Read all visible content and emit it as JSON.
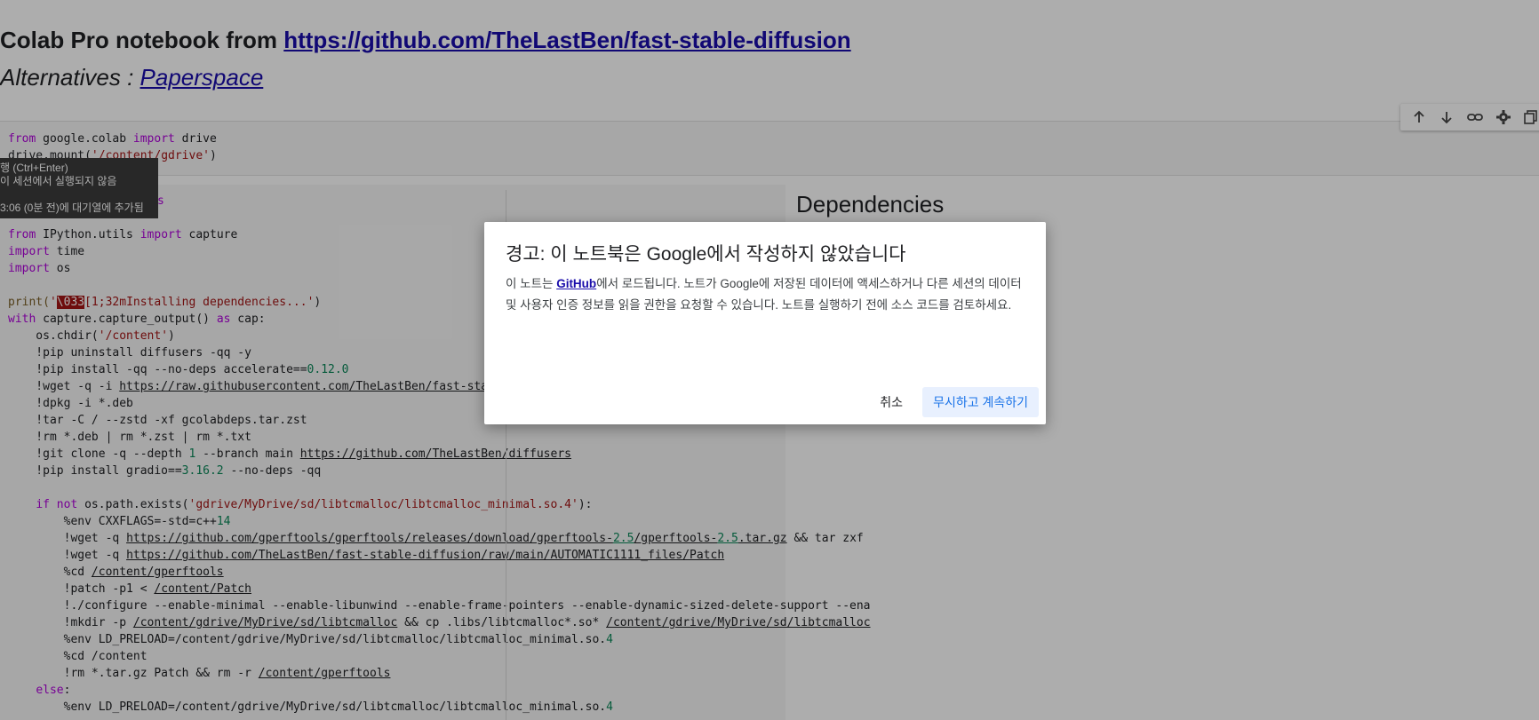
{
  "markdown": {
    "heading_text": "Colab Pro notebook from ",
    "heading_link": "https://github.com/TheLastBen/fast-stable-diffusion",
    "alt_text": "Alternatives : ",
    "alt_link": "Paperspace"
  },
  "cell_toolbar": {
    "icons": [
      "arrow-up-icon",
      "arrow-down-icon",
      "link-icon",
      "gear-icon",
      "copy-icon"
    ]
  },
  "cell1_code": {
    "line1_a": "from",
    "line1_b": " google.colab ",
    "line1_c": "import",
    "line1_d": " drive",
    "line2_a": "drive.mount(",
    "line2_b": "'/content/gdrive'",
    "line2_c": ")"
  },
  "tooltip": {
    "line1": "행 (Ctrl+Enter)",
    "line2": "이 세션에서 실행되지 않음",
    "line3": "",
    "line4": "3:06 (0분 전)에 대기열에 추가됨",
    "cell_fragment": "s"
  },
  "cell2_code": {
    "l1": [
      "from",
      " IPython.utils ",
      "import",
      " capture"
    ],
    "l2": [
      "import",
      " time"
    ],
    "l3": [
      "import",
      " os"
    ],
    "l5": [
      "print(",
      "'",
      "\\033",
      "[1;32mInstalling dependencies...'",
      ")"
    ],
    "l6": [
      "with",
      " capture.capture_output() ",
      "as",
      " cap:"
    ],
    "l7": [
      "    os.chdir(",
      "'/content'",
      ")"
    ],
    "l8": "    !pip uninstall diffusers -qq -y",
    "l9": [
      "    !pip install -qq --no-deps accelerate==",
      "0.12.0"
    ],
    "l10": [
      "    !wget -q -i ",
      "https://raw.githubusercontent.com/TheLastBen/fast-stable-diff"
    ],
    "l11": "    !dpkg -i *.deb",
    "l12": "    !tar -C / --zstd -xf gcolabdeps.tar.zst",
    "l13": "    !rm *.deb | rm *.zst | rm *.txt",
    "l14": [
      "    !git clone -q --depth ",
      "1",
      " --branch main ",
      "https://github.com/TheLastBen/diffusers"
    ],
    "l15": [
      "    !pip install gradio==",
      "3.16.2",
      " --no-deps -qq"
    ],
    "l17": [
      "    ",
      "if not",
      " os.path.exists(",
      "'gdrive/MyDrive/sd/libtcmalloc/libtcmalloc_minimal.so.4'",
      "):"
    ],
    "l18": [
      "        %env CXXFLAGS=-std=c++",
      "14"
    ],
    "l19": [
      "        !wget -q ",
      "https://github.com/gperftools/gperftools/releases/download/gperftools-",
      "2.5",
      "/gperftools-",
      "2.5",
      ".tar.gz",
      " && tar zxf"
    ],
    "l20": [
      "        !wget -q ",
      "https://github.com/TheLastBen/fast-stable-diffusion/raw/main/AUTOMATIC1111_files/Patch"
    ],
    "l21": [
      "        %cd ",
      "/content/gperftools"
    ],
    "l22": [
      "        !patch -p1 < ",
      "/content/Patch"
    ],
    "l23": "        !./configure --enable-minimal --enable-libunwind --enable-frame-pointers --enable-dynamic-sized-delete-support --ena",
    "l24": [
      "        !mkdir -p ",
      "/content/gdrive/MyDrive/sd/libtcmalloc",
      " && cp .libs/libtcmalloc*.so* ",
      "/content/gdrive/MyDrive/sd/libtcmalloc"
    ],
    "l25": [
      "        %env LD_PRELOAD=/content/gdrive/MyDrive/sd/libtcmalloc/libtcmalloc_minimal.so.",
      "4"
    ],
    "l26": "        %cd /content",
    "l27": [
      "        !rm *.tar.gz Patch && rm -r ",
      "/content/gperftools"
    ],
    "l28": [
      "    ",
      "else",
      ":"
    ],
    "l29": [
      "        %env LD_PRELOAD=/content/gdrive/MyDrive/sd/libtcmalloc/libtcmalloc_minimal.so.",
      "4"
    ]
  },
  "dependencies_heading": "Dependencies",
  "dialog": {
    "title": "경고: 이 노트북은 Google에서 작성하지 않았습니다",
    "body_pre": "이 노트는 ",
    "body_link": "GitHub",
    "body_post": "에서 로드됩니다. 노트가 Google에 저장된 데이터에 액세스하거나 다른 세션의 데이터 및 사용자 인증 정보를 읽을 권한을 요청할 수 있습니다. 노트를 실행하기 전에 소스 코드를 검토하세요.",
    "cancel": "취소",
    "proceed": "무시하고 계속하기"
  }
}
